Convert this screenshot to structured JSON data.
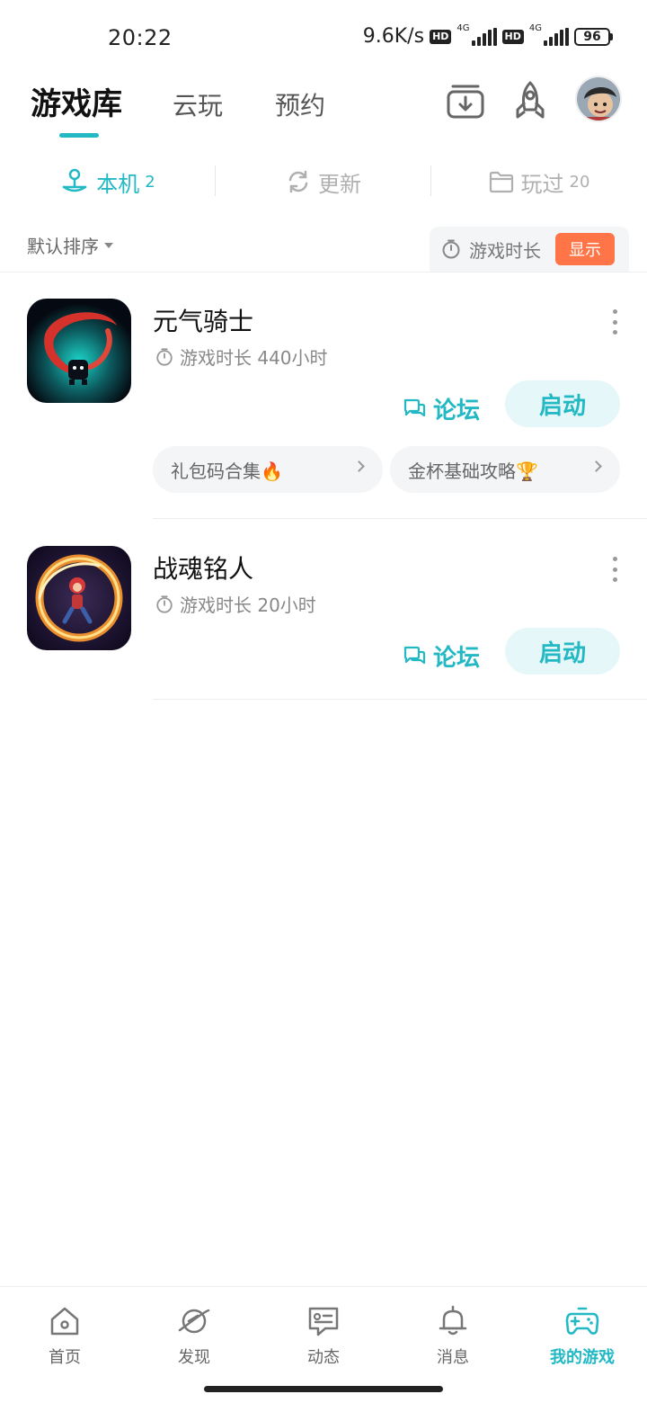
{
  "status_bar": {
    "time": "20:22",
    "net_speed": "9.6K/s",
    "hd": "HD",
    "network_type": "4G",
    "battery": "96"
  },
  "header": {
    "tabs": [
      {
        "label": "游戏库",
        "active": true
      },
      {
        "label": "云玩",
        "active": false
      },
      {
        "label": "预约",
        "active": false
      }
    ],
    "icons": [
      "download-box-icon",
      "rocket-icon",
      "avatar"
    ]
  },
  "sub_tabs": [
    {
      "label": "本机",
      "count": "2",
      "icon": "joystick-icon",
      "active": true
    },
    {
      "label": "更新",
      "count": "",
      "icon": "refresh-icon",
      "active": false
    },
    {
      "label": "玩过",
      "count": "20",
      "icon": "folder-icon",
      "active": false
    }
  ],
  "sort": {
    "label": "默认排序",
    "playtime_label": "游戏时长",
    "show_button": "显示"
  },
  "games": [
    {
      "name": "元气骑士",
      "playtime": "游戏时长 440小时",
      "forum_label": "论坛",
      "launch_label": "启动",
      "chips": [
        "礼包码合集🔥",
        "金杯基础攻略🏆"
      ]
    },
    {
      "name": "战魂铭人",
      "playtime": "游戏时长 20小时",
      "forum_label": "论坛",
      "launch_label": "启动",
      "chips": []
    }
  ],
  "bottom_nav": [
    {
      "label": "首页",
      "icon": "home-icon",
      "active": false
    },
    {
      "label": "发现",
      "icon": "planet-icon",
      "active": false
    },
    {
      "label": "动态",
      "icon": "chat-card-icon",
      "active": false
    },
    {
      "label": "消息",
      "icon": "bell-icon",
      "active": false
    },
    {
      "label": "我的游戏",
      "icon": "gamepad-icon",
      "active": true
    }
  ],
  "colors": {
    "accent": "#22b8c4",
    "show_button": "#ff7547",
    "launch_bg": "#e5f7f8"
  }
}
